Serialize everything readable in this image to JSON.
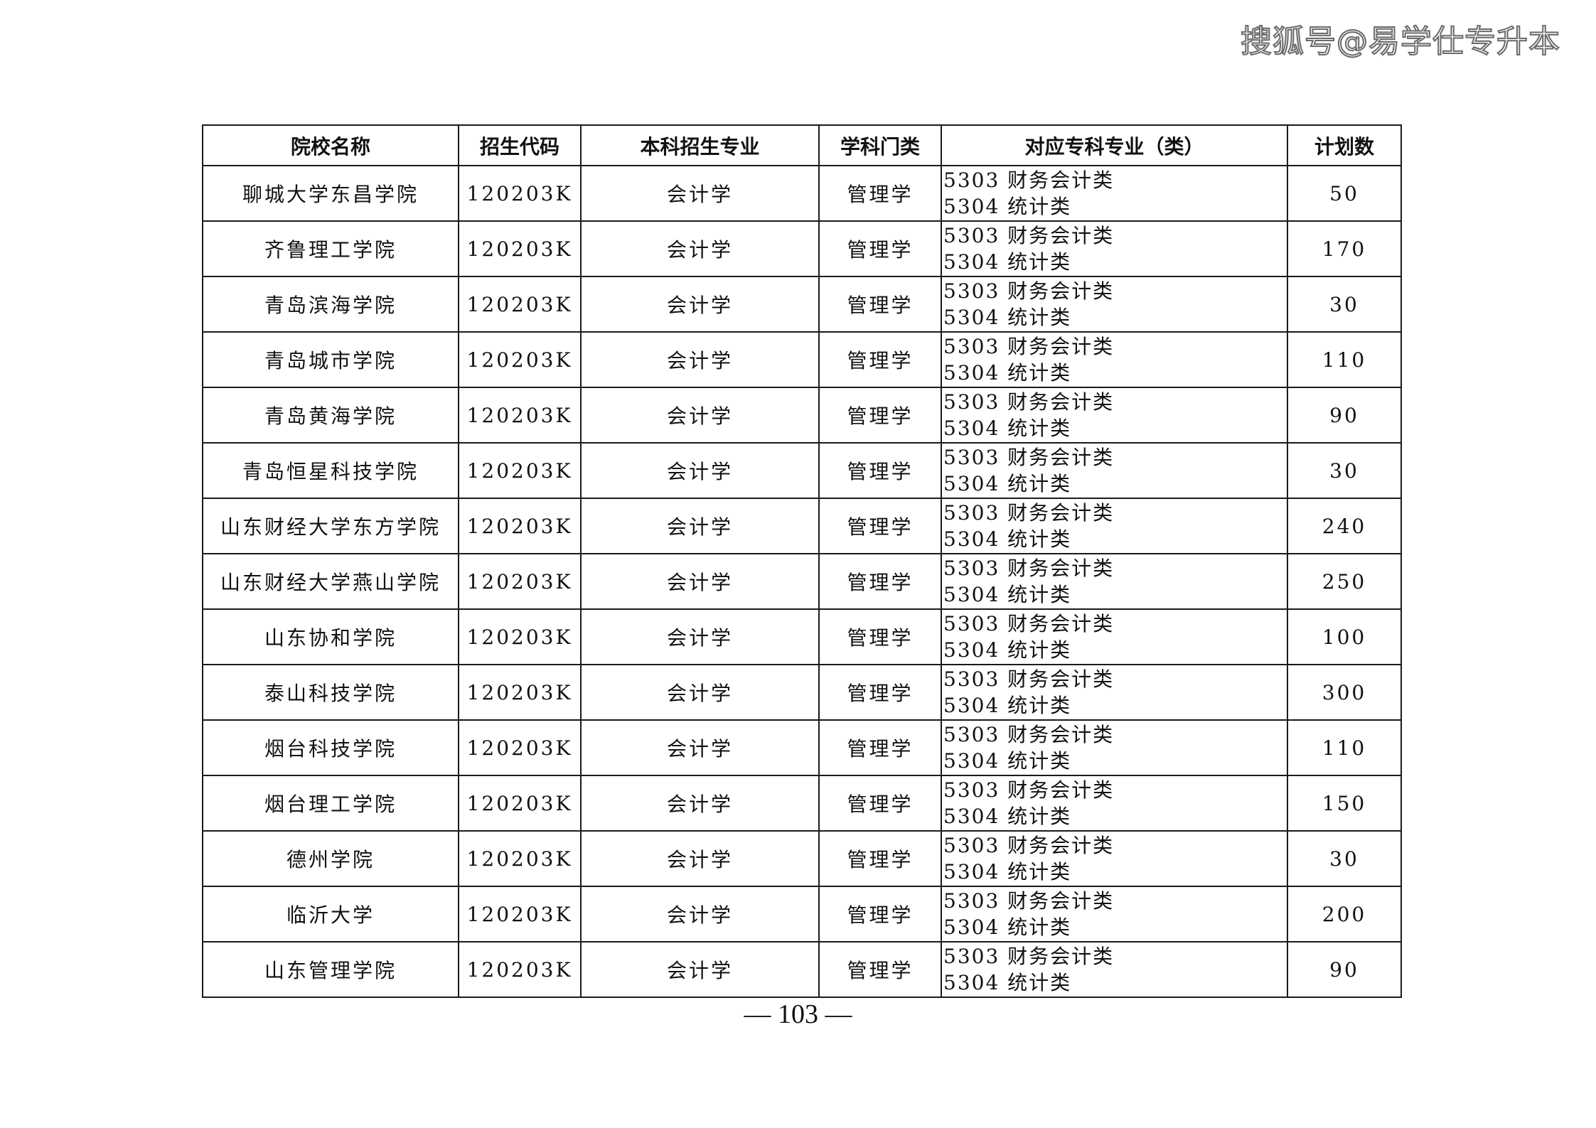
{
  "watermark": "搜狐号@易学仕专升本",
  "table": {
    "headers": {
      "school": "院校名称",
      "code": "招生代码",
      "major": "本科招生专业",
      "category": "学科门类",
      "corresponding": "对应专科专业（类）",
      "plan": "计划数"
    },
    "rows": [
      {
        "school": "聊城大学东昌学院",
        "code": "120203K",
        "major": "会计学",
        "category": "管理学",
        "corr1": "5303 财务会计类",
        "corr2": "5304 统计类",
        "plan": "50"
      },
      {
        "school": "齐鲁理工学院",
        "code": "120203K",
        "major": "会计学",
        "category": "管理学",
        "corr1": "5303 财务会计类",
        "corr2": "5304 统计类",
        "plan": "170"
      },
      {
        "school": "青岛滨海学院",
        "code": "120203K",
        "major": "会计学",
        "category": "管理学",
        "corr1": "5303 财务会计类",
        "corr2": "5304 统计类",
        "plan": "30"
      },
      {
        "school": "青岛城市学院",
        "code": "120203K",
        "major": "会计学",
        "category": "管理学",
        "corr1": "5303 财务会计类",
        "corr2": "5304 统计类",
        "plan": "110"
      },
      {
        "school": "青岛黄海学院",
        "code": "120203K",
        "major": "会计学",
        "category": "管理学",
        "corr1": "5303 财务会计类",
        "corr2": "5304 统计类",
        "plan": "90"
      },
      {
        "school": "青岛恒星科技学院",
        "code": "120203K",
        "major": "会计学",
        "category": "管理学",
        "corr1": "5303 财务会计类",
        "corr2": "5304 统计类",
        "plan": "30"
      },
      {
        "school": "山东财经大学东方学院",
        "code": "120203K",
        "major": "会计学",
        "category": "管理学",
        "corr1": "5303 财务会计类",
        "corr2": "5304 统计类",
        "plan": "240"
      },
      {
        "school": "山东财经大学燕山学院",
        "code": "120203K",
        "major": "会计学",
        "category": "管理学",
        "corr1": "5303 财务会计类",
        "corr2": "5304 统计类",
        "plan": "250"
      },
      {
        "school": "山东协和学院",
        "code": "120203K",
        "major": "会计学",
        "category": "管理学",
        "corr1": "5303 财务会计类",
        "corr2": "5304 统计类",
        "plan": "100"
      },
      {
        "school": "泰山科技学院",
        "code": "120203K",
        "major": "会计学",
        "category": "管理学",
        "corr1": "5303 财务会计类",
        "corr2": "5304 统计类",
        "plan": "300"
      },
      {
        "school": "烟台科技学院",
        "code": "120203K",
        "major": "会计学",
        "category": "管理学",
        "corr1": "5303 财务会计类",
        "corr2": "5304 统计类",
        "plan": "110"
      },
      {
        "school": "烟台理工学院",
        "code": "120203K",
        "major": "会计学",
        "category": "管理学",
        "corr1": "5303 财务会计类",
        "corr2": "5304 统计类",
        "plan": "150"
      },
      {
        "school": "德州学院",
        "code": "120203K",
        "major": "会计学",
        "category": "管理学",
        "corr1": "5303 财务会计类",
        "corr2": "5304 统计类",
        "plan": "30"
      },
      {
        "school": "临沂大学",
        "code": "120203K",
        "major": "会计学",
        "category": "管理学",
        "corr1": "5303 财务会计类",
        "corr2": "5304 统计类",
        "plan": "200"
      },
      {
        "school": "山东管理学院",
        "code": "120203K",
        "major": "会计学",
        "category": "管理学",
        "corr1": "5303 财务会计类",
        "corr2": "5304 统计类",
        "plan": "90"
      }
    ]
  },
  "page_number": "— 103 —"
}
